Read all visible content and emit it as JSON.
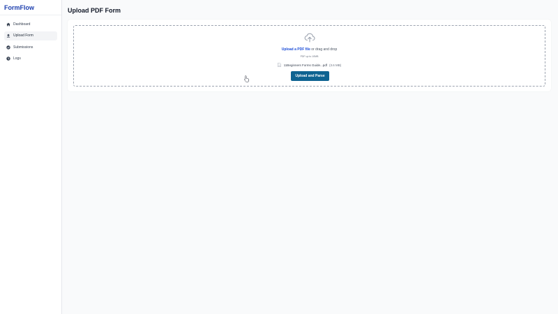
{
  "app": {
    "brand": "FormFlow"
  },
  "sidebar": {
    "items": [
      {
        "label": "Dashboard",
        "icon": "home-icon",
        "active": false
      },
      {
        "label": "Upload Form",
        "icon": "upload-icon",
        "active": true
      },
      {
        "label": "Submissions",
        "icon": "check-circle-icon",
        "active": false
      },
      {
        "label": "Logs",
        "icon": "clock-icon",
        "active": false
      }
    ]
  },
  "main": {
    "title": "Upload PDF Form",
    "dropzone": {
      "icon": "cloud-upload-icon",
      "link_text": "Upload a PDF file",
      "rest_text": " or drag and drop",
      "limit_text": "PDF up to 10MB",
      "file": {
        "name": "11Beginners Forms Guide...pdf",
        "size": "(3.6 MB)",
        "icon": "document-icon"
      },
      "button_label": "Upload and Parse"
    }
  },
  "colors": {
    "brand": "#1e40af",
    "link": "#1d4ed8",
    "button": "#0e6391",
    "active_bg": "#f3f4f6"
  }
}
